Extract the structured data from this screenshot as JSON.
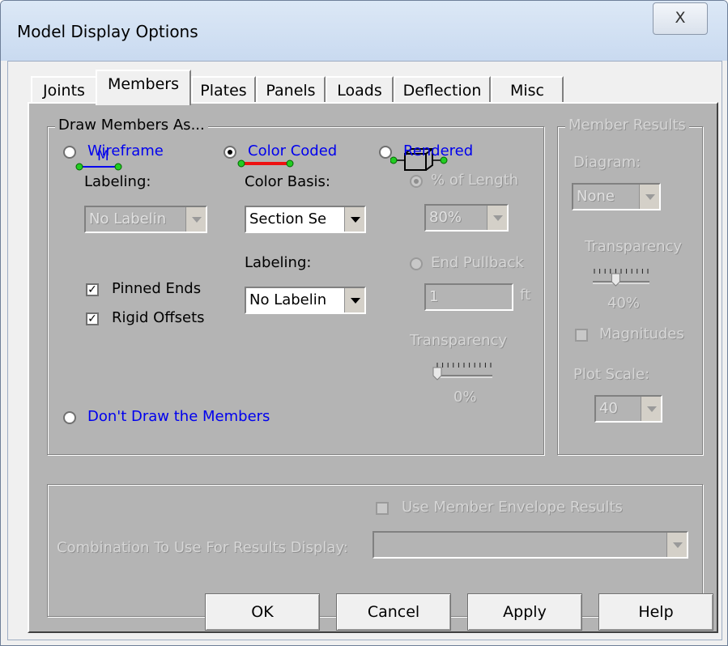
{
  "window": {
    "title": "Model Display Options",
    "close_glyph": "X"
  },
  "tabs": [
    {
      "label": "Joints"
    },
    {
      "label": "Members"
    },
    {
      "label": "Plates"
    },
    {
      "label": "Panels"
    },
    {
      "label": "Loads"
    },
    {
      "label": "Deflection"
    },
    {
      "label": "Misc"
    }
  ],
  "active_tab": "Members",
  "draw": {
    "legend": "Draw Members As...",
    "wireframe_label": "Wireframe",
    "wireframe_icon_text": "M",
    "color_coded_label": "Color Coded",
    "rendered_label": "Rendered",
    "selected": "Color Coded",
    "labeling_label": "Labeling:",
    "labeling_value": "No Labelin",
    "color_basis_label": "Color Basis:",
    "color_basis_value": "Section Se",
    "cc_labeling_label": "Labeling:",
    "cc_labeling_value": "No Labelin",
    "pinned_ends": "Pinned Ends",
    "pinned_checked": true,
    "rigid_offsets": "Rigid Offsets",
    "rigid_checked": true,
    "pct_length": "% of Length",
    "pct_value": "80%",
    "end_pullback": "End Pullback",
    "end_value": "1",
    "end_unit": "ft",
    "transparency_label": "Transparency",
    "transparency_value": "0%",
    "transparency_level": 0,
    "dont_draw": "Don't Draw the Members"
  },
  "results": {
    "legend": "Member Results",
    "diagram_label": "Diagram:",
    "diagram_value": "None",
    "transparency_label": "Transparency",
    "transparency_value": "40%",
    "transparency_level": 0.4,
    "magnitudes": "Magnitudes",
    "plot_scale_label": "Plot Scale:",
    "plot_scale_value": "40"
  },
  "envelope": {
    "use_envelope": "Use Member Envelope Results",
    "combination_label": "Combination To Use For Results Display:",
    "combination_value": ""
  },
  "buttons": {
    "ok": "OK",
    "cancel": "Cancel",
    "apply": "Apply",
    "help": "Help"
  },
  "colors": {
    "color_coded_line": "#ee1111",
    "node_green": "#11aa11",
    "label_blue": "#0000ee"
  }
}
